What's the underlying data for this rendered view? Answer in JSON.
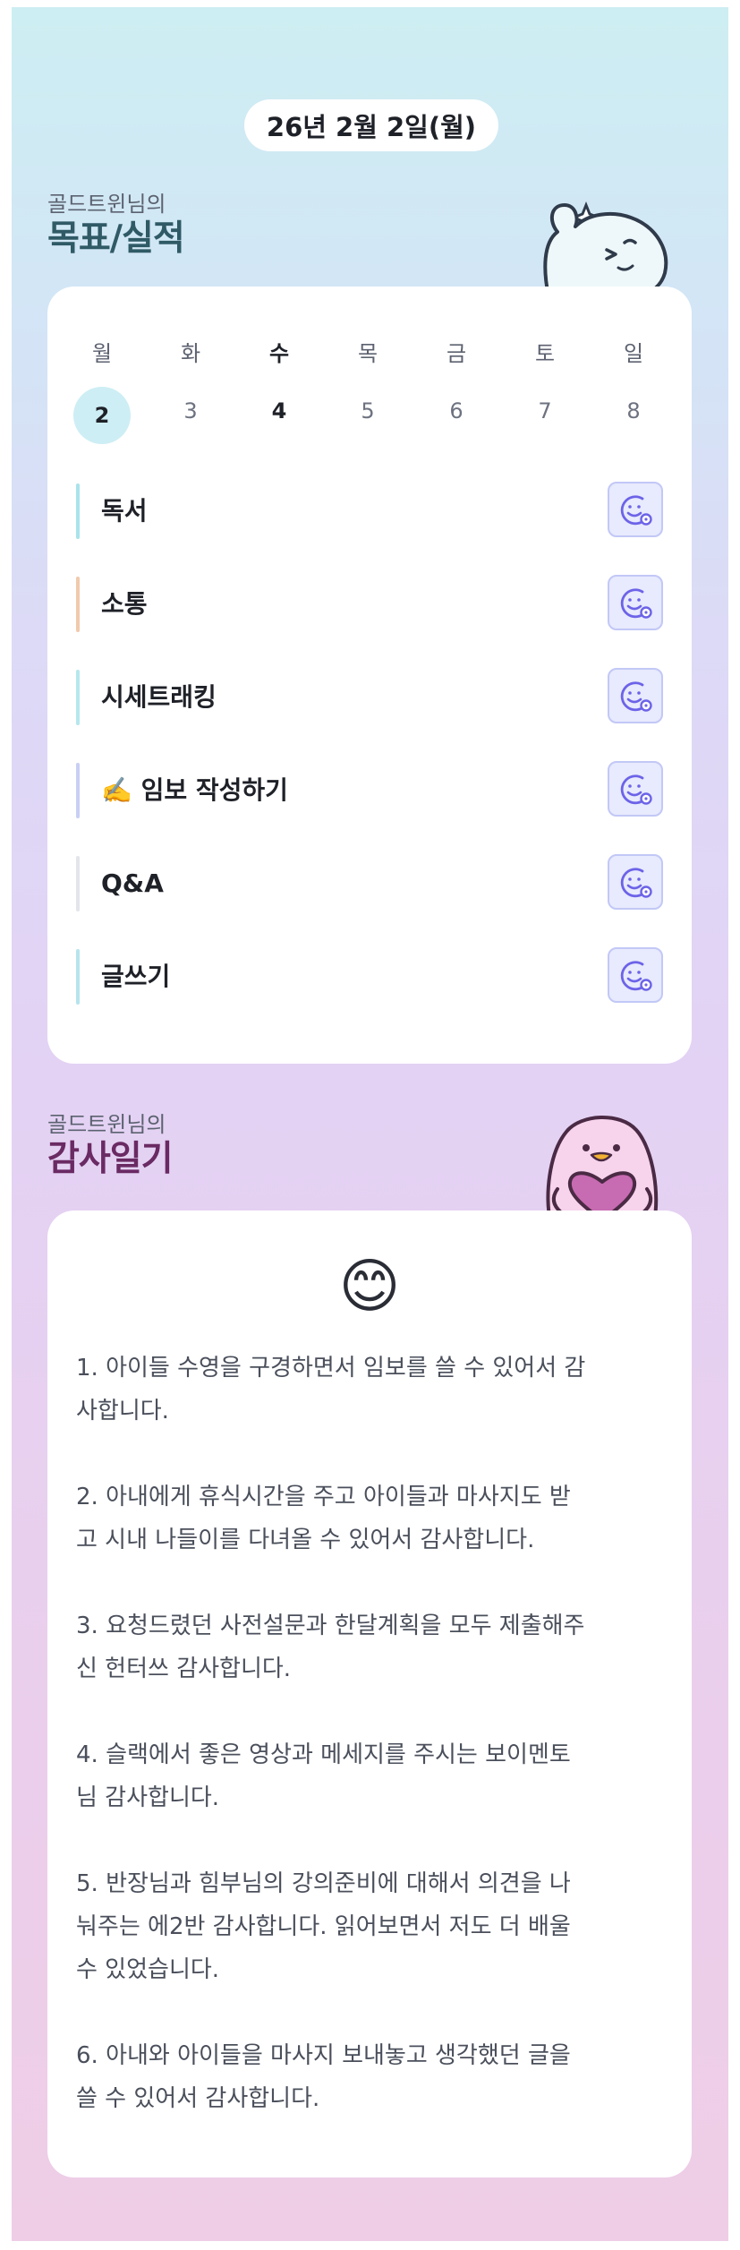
{
  "date_pill": "26년 2월 2일(월)",
  "goals_section": {
    "subtitle": "골드트윈님의",
    "title": "목표/실적"
  },
  "week": {
    "days": [
      {
        "name": "월",
        "num": "2",
        "selected": true,
        "strong": false
      },
      {
        "name": "화",
        "num": "3",
        "selected": false,
        "strong": false
      },
      {
        "name": "수",
        "num": "4",
        "selected": false,
        "strong": true
      },
      {
        "name": "목",
        "num": "5",
        "selected": false,
        "strong": false
      },
      {
        "name": "금",
        "num": "6",
        "selected": false,
        "strong": false
      },
      {
        "name": "토",
        "num": "7",
        "selected": false,
        "strong": false
      },
      {
        "name": "일",
        "num": "8",
        "selected": false,
        "strong": false
      }
    ]
  },
  "goals": [
    {
      "label": "독서",
      "bar_color": "#a9e3ea",
      "icon": "smile-plus-icon"
    },
    {
      "label": "소통",
      "bar_color": "#f1c9ad",
      "icon": "smile-plus-icon"
    },
    {
      "label": "시세트래킹",
      "bar_color": "#b6e7ee",
      "icon": "smile-plus-icon"
    },
    {
      "label": "임보 작성하기",
      "emoji": "✍️",
      "bar_color": "#c8cff5",
      "icon": "smile-plus-icon"
    },
    {
      "label": "Q&A",
      "bar_color": "#e3e5ea",
      "icon": "smile-plus-icon"
    },
    {
      "label": "글쓰기",
      "bar_color": "#b6e4ee",
      "icon": "smile-plus-icon"
    }
  ],
  "gratitude_section": {
    "subtitle": "골드트윈님의",
    "title": "감사일기",
    "emoji": "😊"
  },
  "gratitude_entries": [
    {
      "line1": "1. 아이들 수영을 구경하면서 임보를 쓸 수 있어서 감",
      "line2": "사합니다.",
      "line3": ""
    },
    {
      "line1": "2. 아내에게 휴식시간을 주고 아이들과  마사지도 받",
      "line2": "고 시내 나들이를 다녀올 수 있어서 감사합니다.",
      "line3": ""
    },
    {
      "line1": "3. 요청드렸던 사전설문과 한달계획을 모두 제출해주",
      "line2": "신 헌터쓰 감사합니다.",
      "line3": ""
    },
    {
      "line1": "4. 슬랙에서 좋은 영상과 메세지를 주시는 보이멘토",
      "line2": "님 감사합니다.",
      "line3": ""
    },
    {
      "line1": "5. 반장님과 힘부님의 강의준비에 대해서 의견을 나",
      "line2": "눠주는 에2반 감사합니다. 읽어보면서 저도 더 배울",
      "line3": "수 있었습니다."
    },
    {
      "line1": "6. 아내와 아이들을 마사지 보내놓고 생각했던 글을",
      "line2": "쓸 수 있어서 감사합니다.",
      "line3": ""
    }
  ],
  "colors": {
    "goals_title": "#2f5a66",
    "gratitude_title": "#6a2a63",
    "icon_stroke": "#6c63e8",
    "selected_day_bg": "#cdeef4"
  }
}
